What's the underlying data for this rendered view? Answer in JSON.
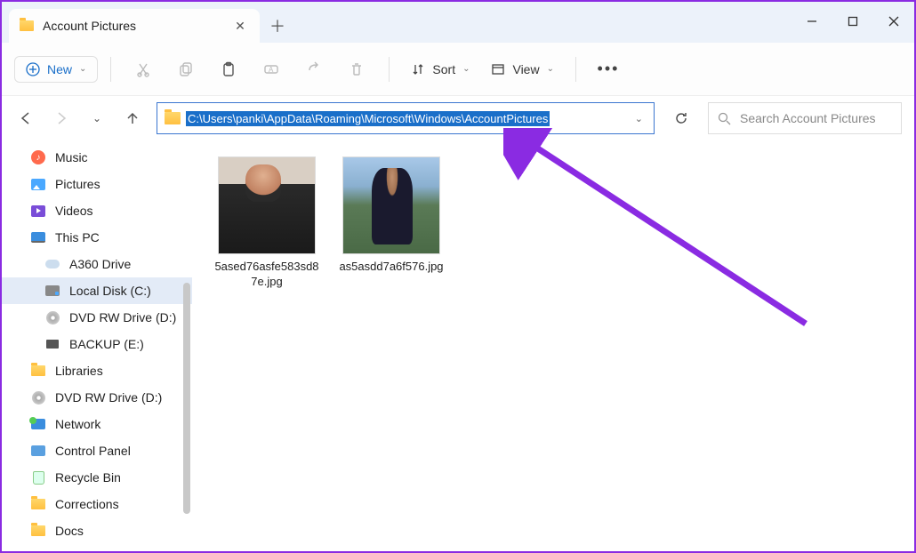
{
  "tab": {
    "title": "Account Pictures"
  },
  "toolbar": {
    "new_label": "New",
    "sort_label": "Sort",
    "view_label": "View"
  },
  "address": {
    "path": "C:\\Users\\panki\\AppData\\Roaming\\Microsoft\\Windows\\AccountPictures"
  },
  "search": {
    "placeholder": "Search Account Pictures"
  },
  "sidebar": {
    "items": [
      {
        "label": "Music",
        "icon": "music"
      },
      {
        "label": "Pictures",
        "icon": "pictures"
      },
      {
        "label": "Videos",
        "icon": "videos"
      },
      {
        "label": "This PC",
        "icon": "thispc"
      },
      {
        "label": "A360 Drive",
        "icon": "cloud",
        "sub": true
      },
      {
        "label": "Local Disk (C:)",
        "icon": "disk",
        "sub": true,
        "selected": true
      },
      {
        "label": "DVD RW Drive (D:)",
        "icon": "dvd",
        "sub": true
      },
      {
        "label": "BACKUP (E:)",
        "icon": "usb",
        "sub": true
      },
      {
        "label": "Libraries",
        "icon": "folder"
      },
      {
        "label": "DVD RW Drive (D:)",
        "icon": "dvd"
      },
      {
        "label": "Network",
        "icon": "network"
      },
      {
        "label": "Control Panel",
        "icon": "control"
      },
      {
        "label": "Recycle Bin",
        "icon": "recycle"
      },
      {
        "label": "Corrections",
        "icon": "folder"
      },
      {
        "label": "Docs",
        "icon": "folder"
      }
    ]
  },
  "files": [
    {
      "name": "5ased76asfe583sd87e.jpg"
    },
    {
      "name": "as5asdd7a6f576.jpg"
    }
  ],
  "colors": {
    "accent": "#1a6fc9",
    "annotation": "#8a2be2"
  }
}
